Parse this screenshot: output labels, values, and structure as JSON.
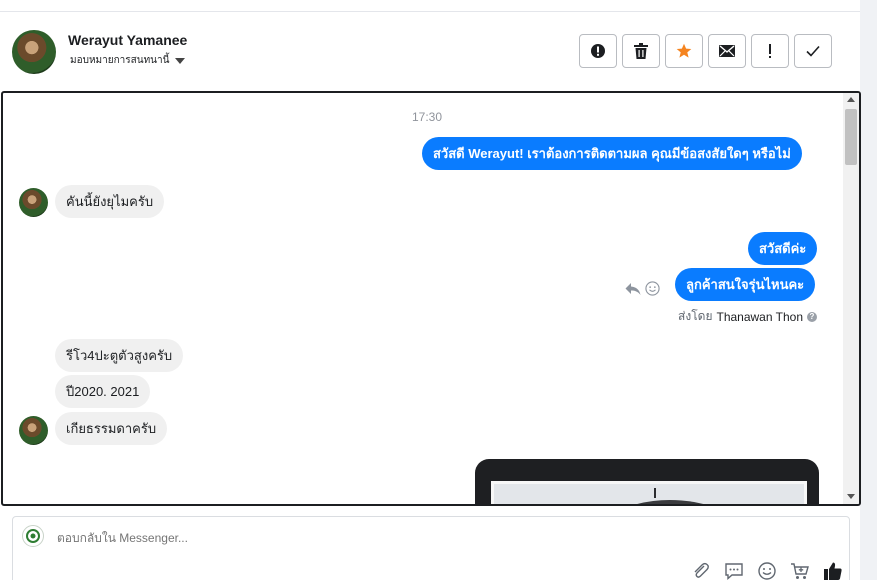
{
  "header": {
    "name": "Werayut Yamanee",
    "assign_label": "มอบหมายการสนทนานี้"
  },
  "actions": [
    {
      "name": "spam-button",
      "icon": "alert-circle-icon"
    },
    {
      "name": "delete-button",
      "icon": "trash-icon"
    },
    {
      "name": "star-button",
      "icon": "star-icon",
      "color": "#f5841f"
    },
    {
      "name": "mark-unread-button",
      "icon": "envelope-icon"
    },
    {
      "name": "priority-button",
      "icon": "exclamation-icon"
    },
    {
      "name": "done-button",
      "icon": "check-icon"
    }
  ],
  "chat": {
    "timestamp": "17:30",
    "messages": {
      "m1": "สวัสดี Werayut! เราต้องการติดตามผล คุณมีข้อสงสัยใดๆ หรือไม่",
      "m2": "คันนี้ยังยุไมครับ",
      "m3": "สวัสดีค่ะ",
      "m4": "ลูกค้าสนใจรุ่นไหนคะ",
      "m5": "รีโว4ปะตูตัวสูงครับ",
      "m6": "ปี2020.  2021",
      "m7": "เกียธรรมดาครับ"
    },
    "sent_by_prefix": "ส่งโดย",
    "sent_by_name": "Thanawan Thon",
    "colors": {
      "outgoing": "#0a7cff",
      "incoming": "#f0f0f0"
    }
  },
  "composer": {
    "placeholder": "ตอบกลับใน Messenger..."
  }
}
